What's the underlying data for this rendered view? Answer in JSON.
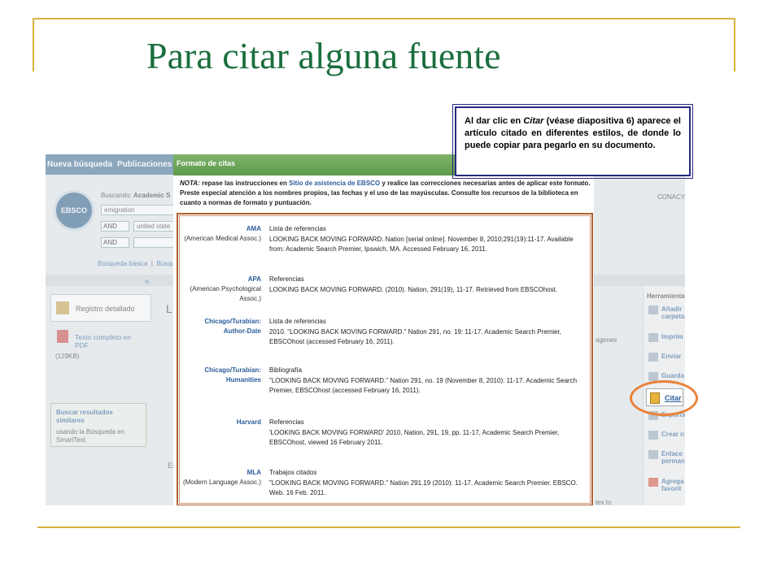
{
  "slide": {
    "title": "Para citar alguna fuente"
  },
  "callout": {
    "prefix": "Al dar clic en ",
    "emph": "Citar",
    "rest": " (véase diapositiva 6) aparece el artículo citado en diferentes estilos, de donde lo puede copiar para pegarlo en su documento."
  },
  "app": {
    "nav": {
      "new_search": "Nueva búsqueda",
      "publications": "Publicaciones"
    },
    "logo": "EBSCO",
    "search": {
      "label": "Buscando:",
      "db": "Academic S",
      "query": "emigration",
      "op1": "AND",
      "row1": "united state",
      "op2": "AND"
    },
    "links": {
      "basic": "Búsqueda básica",
      "sep": "|",
      "advanced": "Búsqued"
    },
    "right_user": "CONACY",
    "collapse": "«",
    "left": {
      "detail": "Registro detallado",
      "fulltext": "Texto completo en PDF",
      "size": "(129KB)",
      "similar_title": "Buscar resultados similares",
      "similar_sub": "usando la Búsqueda en SmartText.",
      "big_letter": "L",
      "e_letter": "Er",
      "images": "agenes",
      "footer": "tex to"
    },
    "tools": {
      "title": "Herramienta",
      "items": [
        "Añadir carpeta",
        "Imprim",
        "Enviar",
        "Guarda",
        "Citar",
        "Exporta",
        "Crear n",
        "Enlace perman",
        "Agrega favorit"
      ]
    }
  },
  "dialog": {
    "title": "Formato de citas",
    "note_label": "NOTA:",
    "note_a": " repase las instrucciones en ",
    "note_link": "Sitio de asistencia de EBSCO",
    "note_b": " y realice las correcciones necesarias antes de aplicar este formato. Preste especial atención a los nombres propios, las fechas y el uso de las mayúsculas. Consulte los recursos de la biblioteca en cuanto a normas de formato y puntuación.",
    "styles": [
      {
        "name": "AMA",
        "sub": "(American Medical Assoc.)",
        "heading": "Lista de referencias",
        "citation": "LOOKING BACK MOVING FORWARD. Nation [serial online]. November 8, 2010;291(19):11-17. Available from: Academic Search Premier, Ipswich, MA. Accessed February 16, 2011."
      },
      {
        "name": "APA",
        "sub": "(American Psychological Assoc.)",
        "heading": "Referencias",
        "citation": "LOOKING BACK MOVING FORWARD. (2010). Nation, 291(19), 11-17. Retrieved from EBSCOhost."
      },
      {
        "name": "Chicago/Turabian: Author-Date",
        "sub": "",
        "heading": "Lista de referencias",
        "citation": "2010. \"LOOKING BACK MOVING FORWARD.\" Nation 291, no. 19: 11-17. Academic Search Premier, EBSCOhost (accessed February 16, 2011)."
      },
      {
        "name": "Chicago/Turabian: Humanities",
        "sub": "",
        "heading": "Bibliografía",
        "citation": "\"LOOKING BACK MOVING FORWARD.\" Nation 291, no. 19 (November 8, 2010): 11-17. Academic Search Premier, EBSCOhost (accessed February 16, 2011)."
      },
      {
        "name": "Harvard",
        "sub": "",
        "heading": "Referencias",
        "citation": "'LOOKING BACK MOVING FORWARD' 2010, Nation, 291, 19, pp. 11-17, Academic Search Premier, EBSCOhost, viewed 16 February 2011."
      },
      {
        "name": "MLA",
        "sub": "(Modern Language Assoc.)",
        "heading": "Trabajos citados",
        "citation": "\"LOOKING BACK MOVING FORWARD.\" Nation 291.19 (2010): 11-17. Academic Search Premier. EBSCO. Web. 16 Feb. 2011."
      }
    ]
  },
  "colors": {
    "title_green": "#1a6e3e",
    "rule_gold": "#d6b43a",
    "callout_border": "#27297f",
    "highlight_orange": "#e9823a",
    "cite_border": "#b06230"
  }
}
